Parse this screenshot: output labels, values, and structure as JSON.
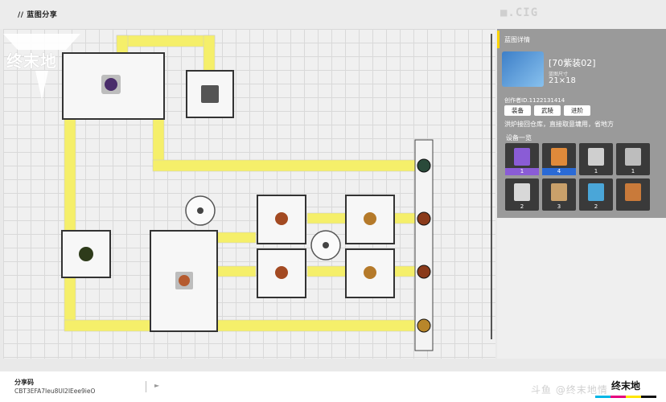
{
  "header": {
    "title": "// 蓝图分享",
    "logo_text": "■.CIG"
  },
  "brand": {
    "name": "终末地"
  },
  "blueprint": {
    "panel_title": "蓝图详情",
    "name": "[70紫装02]",
    "size_label": "蓝图尺寸",
    "size": "21×18",
    "author": "创作者ID.1122131414",
    "tags": [
      "装备",
      "武陵",
      "进阶"
    ],
    "description": "洪炉接回仓库，直接取意墉用，省地方",
    "equipment_title": "设备一览",
    "equipment": [
      {
        "count": "1",
        "color": "#8a5cd6"
      },
      {
        "count": "4",
        "color": "#e08a3a"
      },
      {
        "count": "1",
        "color": "#cfcfcf"
      },
      {
        "count": "1",
        "color": "#bdbdbd"
      },
      {
        "count": "2",
        "color": "#d8d8d8"
      },
      {
        "count": "3",
        "color": "#c9a06a"
      },
      {
        "count": "2",
        "color": "#4aa6d8"
      },
      {
        "count": "",
        "color": "#c97a3a"
      }
    ]
  },
  "share": {
    "label": "分享码",
    "code": "CBT3EFA7Ieu8UI2IEee9ieO"
  },
  "watermark": "斗鱼 @终末地情",
  "colors": {
    "belt": "#f5ef6a",
    "accent": "#ffd400",
    "panel": "#8c8c8c"
  }
}
